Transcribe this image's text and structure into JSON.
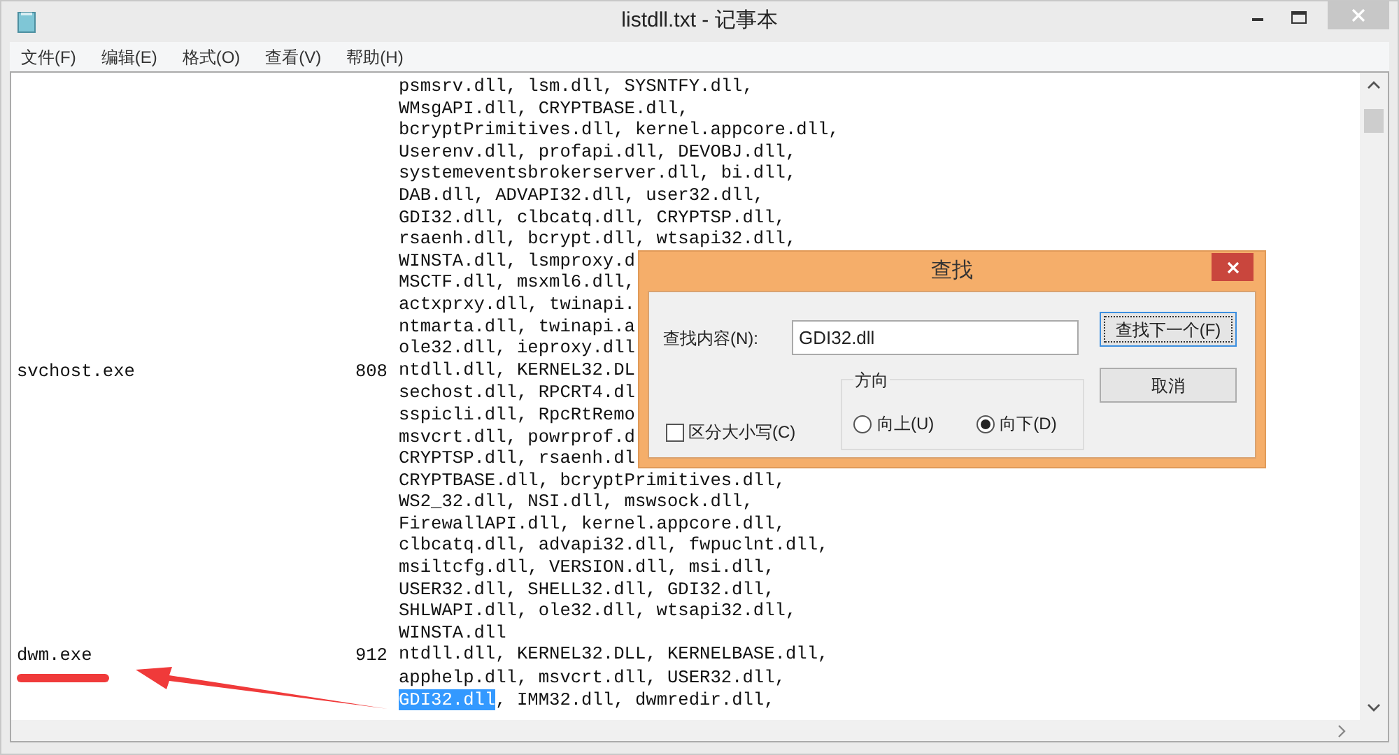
{
  "window": {
    "title": "listdll.txt - 记事本"
  },
  "menu": [
    "文件(F)",
    "编辑(E)",
    "格式(O)",
    "查看(V)",
    "帮助(H)"
  ],
  "lines": [
    {
      "text": "psmsrv.dll, lsm.dll, SYSNTFY.dll,"
    },
    {
      "text": "WMsgAPI.dll, CRYPTBASE.dll,"
    },
    {
      "text": "bcryptPrimitives.dll, kernel.appcore.dll,"
    },
    {
      "text": "Userenv.dll, profapi.dll, DEVOBJ.dll,"
    },
    {
      "text": "systemeventsbrokerserver.dll, bi.dll,"
    },
    {
      "text": "DAB.dll, ADVAPI32.dll, user32.dll,"
    },
    {
      "text": "GDI32.dll, clbcatq.dll, CRYPTSP.dll,"
    },
    {
      "text": "rsaenh.dll, bcrypt.dll, wtsapi32.dll,"
    },
    {
      "text": "WINSTA.dll, lsmproxy.d"
    },
    {
      "text": "MSCTF.dll, msxml6.dll,"
    },
    {
      "text": "actxprxy.dll, twinapi."
    },
    {
      "text": "ntmarta.dll, twinapi.a"
    },
    {
      "text": "ole32.dll, ieproxy.dll"
    },
    {
      "process": "svchost.exe",
      "pid": "808",
      "text": "ntdll.dll, KERNEL32.DL"
    },
    {
      "text": "sechost.dll, RPCRT4.dl"
    },
    {
      "text": "sspicli.dll, RpcRtRemo"
    },
    {
      "text": "msvcrt.dll, powrprof.d"
    },
    {
      "text": "CRYPTSP.dll, rsaenh.dl"
    },
    {
      "text": "CRYPTBASE.dll, bcryptPrimitives.dll,"
    },
    {
      "text": "WS2_32.dll, NSI.dll, mswsock.dll,"
    },
    {
      "text": "FirewallAPI.dll, kernel.appcore.dll,"
    },
    {
      "text": "clbcatq.dll, advapi32.dll, fwpuclnt.dll,"
    },
    {
      "text": "msiltcfg.dll, VERSION.dll, msi.dll,"
    },
    {
      "text": "USER32.dll, SHELL32.dll, GDI32.dll,"
    },
    {
      "text": "SHLWAPI.dll, ole32.dll, wtsapi32.dll,"
    },
    {
      "text": "WINSTA.dll"
    },
    {
      "process": "dwm.exe",
      "pid": "912",
      "text": "ntdll.dll, KERNEL32.DLL, KERNELBASE.dll,"
    },
    {
      "text": "apphelp.dll, msvcrt.dll, USER32.dll,"
    },
    {
      "highlight": "GDI32.dll",
      "text": ", IMM32.dll, dwmredir.dll,"
    }
  ],
  "find_dialog": {
    "title": "查找",
    "find_label": "查找内容(N):",
    "find_value": "GDI32.dll",
    "find_next_button": "查找下一个(F)",
    "cancel_button": "取消",
    "match_case": {
      "label": "区分大小写(C)",
      "checked": false
    },
    "direction": {
      "label": "方向",
      "options": [
        {
          "label": "向上(U)",
          "selected": false
        },
        {
          "label": "向下(D)",
          "selected": true
        }
      ]
    }
  }
}
